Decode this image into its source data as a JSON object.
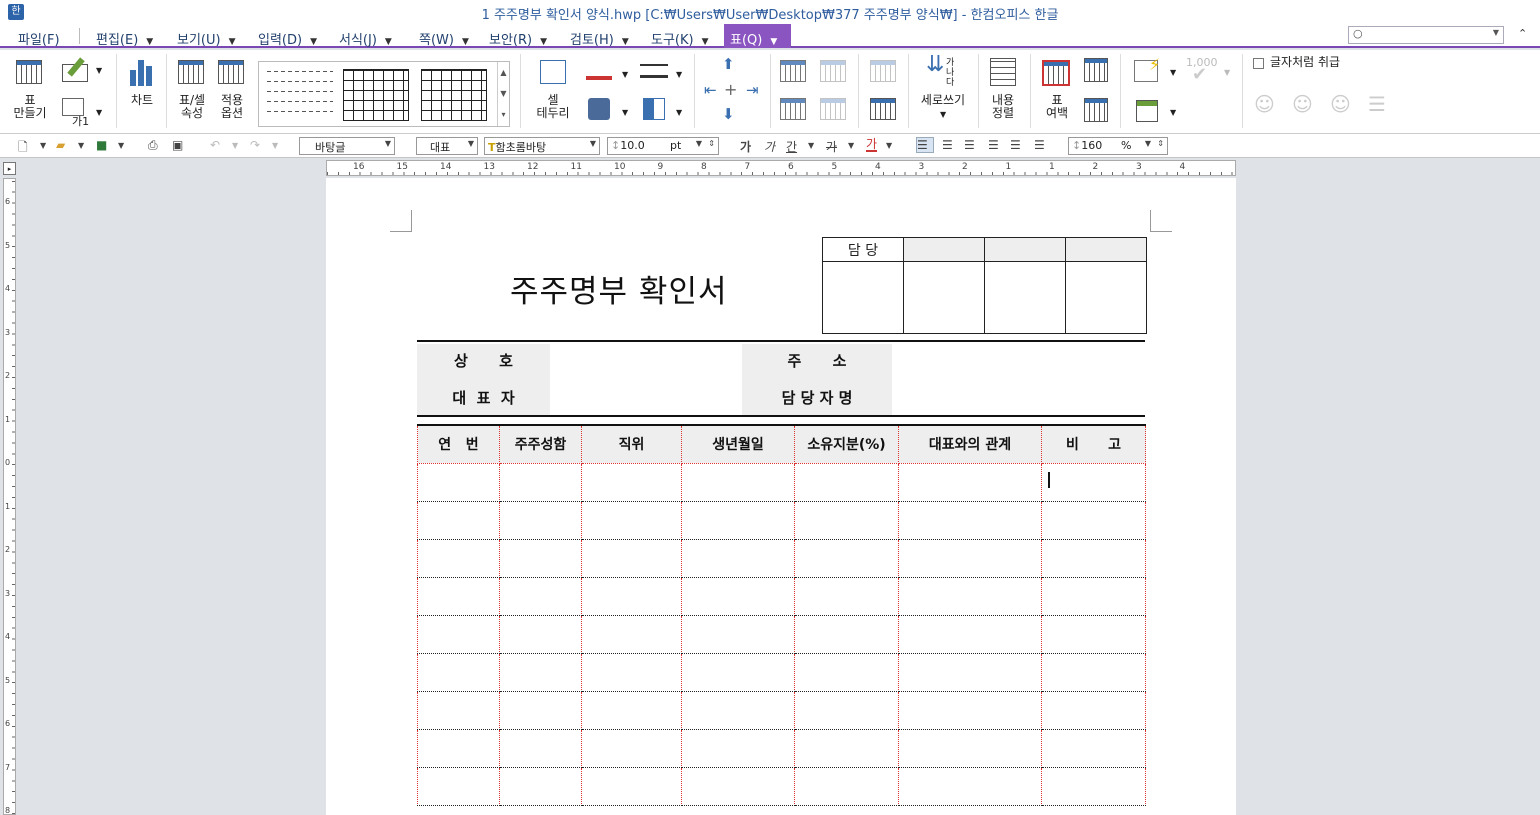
{
  "window": {
    "title": "1 주주명부 확인서 양식.hwp [C:₩Users₩User₩Desktop₩377 주주명부 양식₩] - 한컴오피스 한글"
  },
  "menu": [
    {
      "label": "파일(F)"
    },
    {
      "label": "편집(E)"
    },
    {
      "label": "보기(U)"
    },
    {
      "label": "입력(D)"
    },
    {
      "label": "서식(J)"
    },
    {
      "label": "쪽(W)"
    },
    {
      "label": "보안(R)"
    },
    {
      "label": "검토(H)"
    },
    {
      "label": "도구(K)"
    },
    {
      "label": "표(Q)"
    }
  ],
  "menu_search_placeholder": "○",
  "ribbon": {
    "make_table": "표\n만들기",
    "gayi": "가1",
    "chart": "차트",
    "table_cell_props": "표/셀\n속성",
    "apply_options": "적용\n옵션",
    "cell_border": "셀\n테두리",
    "vertical_write": "세로쓰기",
    "vertical_glyphs": "가\n나\n다",
    "content_align": "내용\n정렬",
    "table_margin": "표\n여백",
    "thousand": "1,000",
    "treat_as_char": "글자처럼 취급"
  },
  "toolbar2": {
    "style": "바탕글",
    "para": "대표",
    "font": "함초롬바탕",
    "size": "10.0",
    "unit": "pt",
    "bold": "가",
    "italic": "가",
    "underline": "간",
    "strike": "가",
    "color": "가",
    "zoom": "160",
    "zoom_unit": "%"
  },
  "ruler_h_numbers": [
    "16",
    "15",
    "14",
    "13",
    "12",
    "11",
    "10",
    "9",
    "8",
    "7",
    "6",
    "5",
    "4",
    "3",
    "2",
    "1",
    "1",
    "2",
    "3",
    "4"
  ],
  "ruler_v_numbers": [
    "6",
    "5",
    "4",
    "3",
    "2",
    "1",
    "0",
    "1",
    "2",
    "3",
    "4",
    "5",
    "6",
    "7",
    "8"
  ],
  "document": {
    "title": "주주명부 확인서",
    "sign_header": "담   당",
    "info": {
      "company_label": "상      호",
      "address_label": "주      소",
      "ceo_label": "대  표  자",
      "manager_label": "담 당 자 명"
    },
    "columns": [
      "연   번",
      "주주성함",
      "직위",
      "생년월일",
      "소유지분(%)",
      "대표와의 관계",
      "비      고"
    ],
    "row_count": 9
  }
}
